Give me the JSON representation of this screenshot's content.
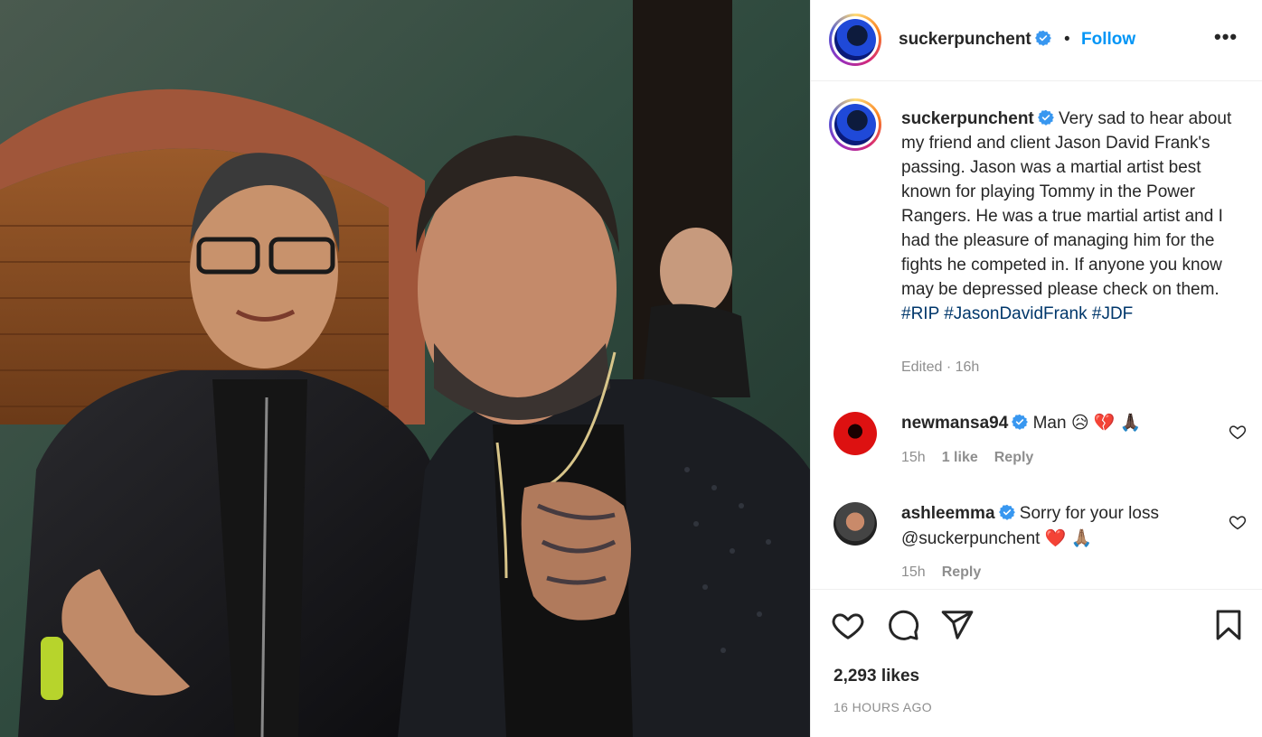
{
  "post": {
    "username": "suckerpunchent",
    "follow_label": "Follow",
    "separator": "•",
    "more_label": "•••"
  },
  "caption": {
    "username": "suckerpunchent",
    "body": " Very sad to hear about my friend and client Jason David Frank's passing. Jason was a martial artist best known for playing Tommy in the Power Rangers. He was a true martial artist and I had the pleasure of managing him for the fights he competed in. If anyone you know may be depressed please check on them. ",
    "hashtags": [
      "#RIP",
      "#JasonDavidFrank",
      "#JDF"
    ],
    "meta": "Edited · 16h"
  },
  "comments": [
    {
      "username": "newmansa94",
      "text": " Man 😥 💔 🙏🏿",
      "time": "15h",
      "likes": "1 like",
      "reply": "Reply"
    },
    {
      "username": "ashleemma",
      "text": " Sorry for your loss @suckerpunchent ❤️ 🙏🏽",
      "time": "15h",
      "reply": "Reply"
    }
  ],
  "footer": {
    "likes": "2,293 likes",
    "timestamp": "16 HOURS AGO"
  },
  "icons": {
    "header": [
      "verified-badge-icon",
      "more-options-icon"
    ],
    "actions": [
      "like-heart-icon",
      "comment-bubble-icon",
      "share-plane-icon",
      "save-bookmark-icon"
    ]
  },
  "colors": {
    "link": "#0095f6",
    "hashtag": "#00376b",
    "muted": "#8e8e8e",
    "verified": "#3897f0"
  }
}
